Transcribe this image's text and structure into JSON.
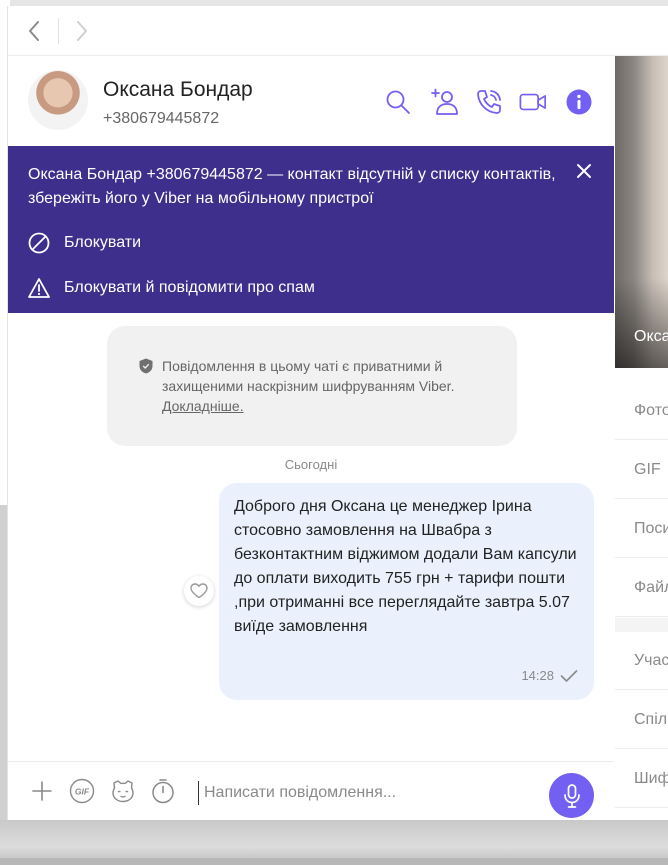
{
  "nav": {
    "back_label": "‹",
    "forward_label": "›"
  },
  "contact": {
    "name": "Оксана Бондар",
    "phone": "+380679445872"
  },
  "header_icons": [
    "search-icon",
    "add-contact-icon",
    "phone-icon",
    "video-icon",
    "info-icon"
  ],
  "banner": {
    "text": "Оксана Бондар +380679445872 — контакт відсутній у списку контактів, збережіть його у Viber на мобільному пристрої",
    "block_label": "Блокувати",
    "block_spam_label": "Блокувати й повідомити про спам"
  },
  "secure_notice": {
    "text": "Повідомлення в цьому чаті є приватними й захищеними наскрізним шифруванням Viber.",
    "link": "Докладніше."
  },
  "date_label": "Сьогодні",
  "message": {
    "text": "Доброго дня Оксана це менеджер Ірина стосовно замовлення на Швабра з безконтактним віджимом додали Вам капсули до оплати виходить 755 грн + тарифи пошти ,при отриманні все переглядайте завтра 5.07 виїде замовлення",
    "time": "14:28"
  },
  "composer": {
    "placeholder": "Написати повідомлення..."
  },
  "info_panel": {
    "name": "Оксана Бондар",
    "items": [
      "Фото",
      "GIF",
      "Посилання",
      "Файли",
      "Учасники",
      "Спільні групи",
      "Шифрування"
    ]
  },
  "colors": {
    "accent": "#7360f2",
    "banner": "#3e2f8c",
    "bubble": "#eaf1fd"
  }
}
